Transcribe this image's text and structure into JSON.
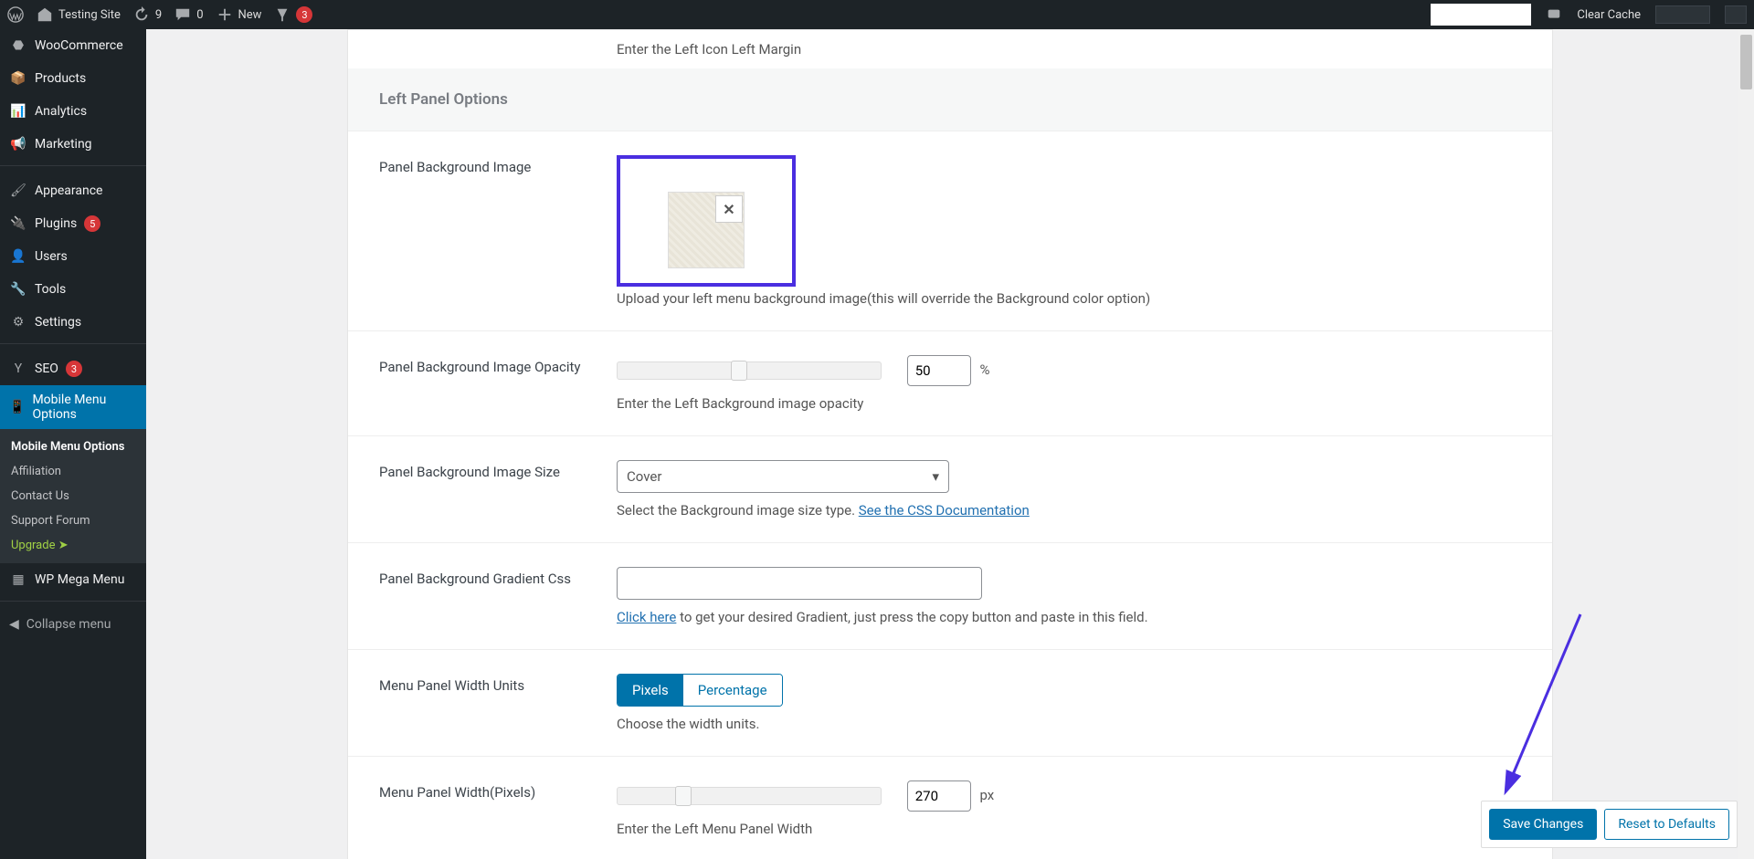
{
  "adminBar": {
    "siteName": "Testing Site",
    "updates": "9",
    "comments": "0",
    "new": "New",
    "notifications": "3",
    "clearCache": "Clear Cache"
  },
  "sidebar": {
    "woocommerce": "WooCommerce",
    "products": "Products",
    "analytics": "Analytics",
    "marketing": "Marketing",
    "appearance": "Appearance",
    "plugins": "Plugins",
    "pluginsCount": "5",
    "users": "Users",
    "tools": "Tools",
    "settings": "Settings",
    "seo": "SEO",
    "seoCount": "3",
    "mobileMenu": "Mobile Menu Options",
    "wpMegaMenu": "WP Mega Menu",
    "collapse": "Collapse menu",
    "submenu": {
      "options": "Mobile Menu Options",
      "affiliation": "Affiliation",
      "contact": "Contact Us",
      "support": "Support Forum",
      "upgrade": "Upgrade  ➤"
    }
  },
  "fields": {
    "leftIconHelp": "Enter the Left Icon Left Margin",
    "sectionTitle": "Left Panel Options",
    "bgImage": {
      "label": "Panel Background Image",
      "help": "Upload your left menu background image(this will override the Background color option)"
    },
    "opacity": {
      "label": "Panel Background Image Opacity",
      "value": "50",
      "unit": "%",
      "help": "Enter the Left Background image opacity"
    },
    "size": {
      "label": "Panel Background Image Size",
      "selected": "Cover",
      "help": "Select the Background image size type. ",
      "link": "See the CSS Documentation"
    },
    "gradient": {
      "label": "Panel Background Gradient Css",
      "value": "",
      "linkText": "Click here",
      "help": " to get your desired Gradient, just press the copy button and paste in this field."
    },
    "widthUnits": {
      "label": "Menu Panel Width Units",
      "opt1": "Pixels",
      "opt2": "Percentage",
      "help": "Choose the width units."
    },
    "width": {
      "label": "Menu Panel Width(Pixels)",
      "value": "270",
      "unit": "px",
      "help": "Enter the Left Menu Panel Width"
    }
  },
  "footer": {
    "save": "Save Changes",
    "reset": "Reset to Defaults"
  }
}
